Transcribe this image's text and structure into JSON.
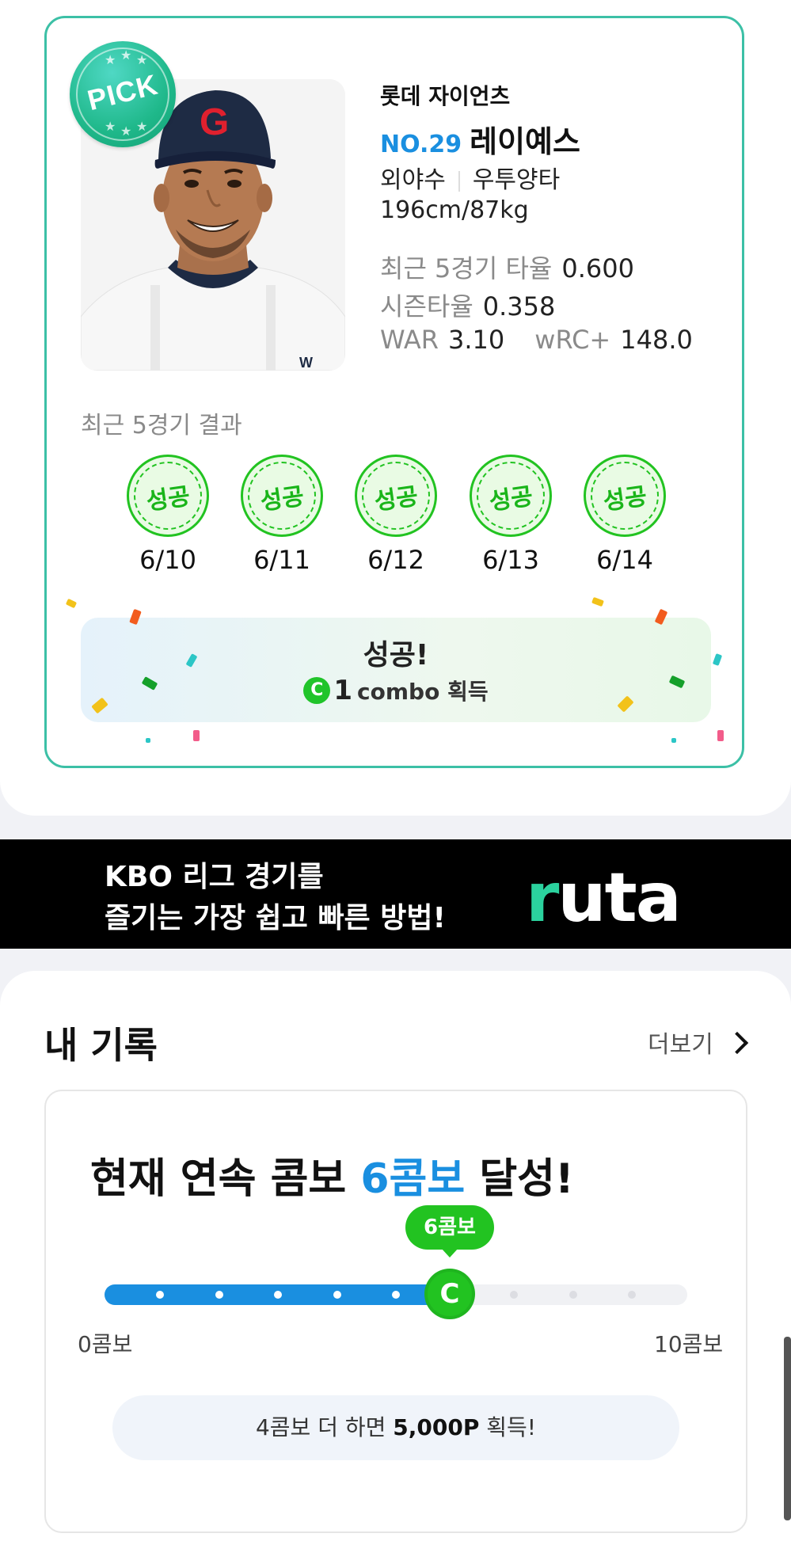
{
  "player": {
    "badge": "PICK",
    "team": "롯데 자이언츠",
    "number": "NO.29",
    "name": "레이예스",
    "position": "외야수",
    "bats": "우투양타",
    "body": "196cm/87kg",
    "stats": {
      "recent5_label": "최근 5경기 타율",
      "recent5_value": "0.600",
      "season_label": "시즌타율",
      "season_value": "0.358",
      "war_label": "WAR",
      "war_value": "3.10",
      "wrc_label": "wRC+",
      "wrc_value": "148.0"
    }
  },
  "recent_results": {
    "title": "최근 5경기 결과",
    "items": [
      {
        "result": "성공",
        "date": "6/10"
      },
      {
        "result": "성공",
        "date": "6/11"
      },
      {
        "result": "성공",
        "date": "6/12"
      },
      {
        "result": "성공",
        "date": "6/13"
      },
      {
        "result": "성공",
        "date": "6/14"
      }
    ]
  },
  "success_banner": {
    "title": "성공!",
    "combo_icon": "C",
    "combo_count": "1",
    "combo_text": "combo 획득"
  },
  "ad": {
    "line1": "KBO 리그 경기를",
    "line2": "즐기는 가장 쉽고 빠른 방법!",
    "logo_r": "r",
    "logo_rest": "uta"
  },
  "records": {
    "title": "내 기록",
    "more_label": "더보기",
    "headline_prefix": "현재 연속 콤보 ",
    "headline_highlight": "6콤보",
    "headline_suffix": " 달성!",
    "tooltip": "6콤보",
    "marker_icon": "C",
    "current_combo": 6,
    "max_combo": 10,
    "scale_min": "0콤보",
    "scale_max": "10콤보",
    "reward_prefix": "4콤보 더 하면 ",
    "reward_bold": "5,000P",
    "reward_suffix": " 획득!"
  },
  "colors": {
    "accent_blue": "#1a8fe0",
    "success_green": "#22c321",
    "card_border": "#3cc0a6"
  }
}
